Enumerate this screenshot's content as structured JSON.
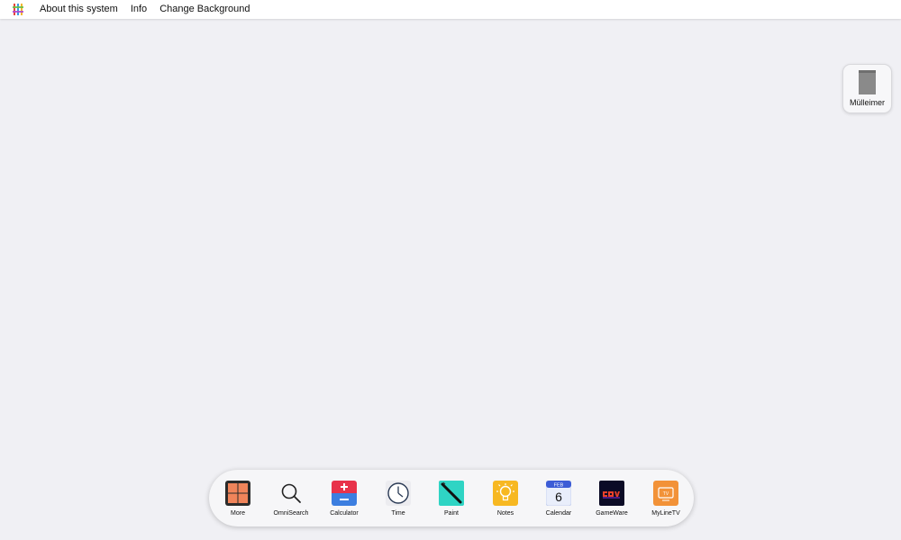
{
  "menubar": {
    "items": [
      {
        "label": "About this system"
      },
      {
        "label": "Info"
      },
      {
        "label": "Change Background"
      }
    ]
  },
  "desktop": {
    "trash_label": "Mülleimer"
  },
  "dock": {
    "items": [
      {
        "label": "More",
        "icon": "grid-icon"
      },
      {
        "label": "OmniSearch",
        "icon": "search-icon"
      },
      {
        "label": "Calculator",
        "icon": "calculator-icon"
      },
      {
        "label": "Time",
        "icon": "clock-icon"
      },
      {
        "label": "Paint",
        "icon": "paint-icon"
      },
      {
        "label": "Notes",
        "icon": "lightbulb-icon"
      },
      {
        "label": "Calendar",
        "icon": "calendar-icon",
        "month": "FEB",
        "day": "6"
      },
      {
        "label": "GameWare",
        "icon": "gameware-icon"
      },
      {
        "label": "MyLineTV",
        "icon": "tv-icon",
        "badge": "TV"
      }
    ]
  }
}
